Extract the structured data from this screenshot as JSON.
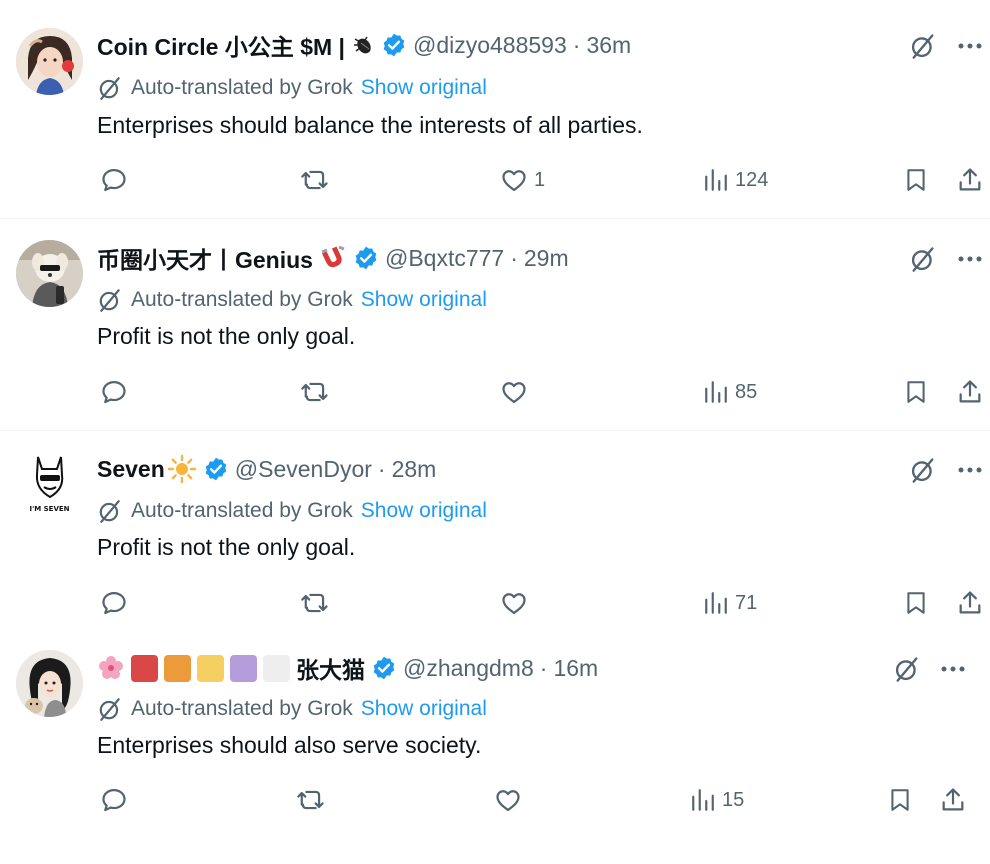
{
  "colors": {
    "verified": "#1d9bf0",
    "link": "#1d9bf0",
    "muted": "#536471",
    "text": "#0f1419"
  },
  "common": {
    "translated_label": "Auto-translated by Grok",
    "show_original": "Show original",
    "separator": "·"
  },
  "tweets": [
    {
      "name": "Coin Circle 小公主 $M |",
      "name_emoji": "bug",
      "handle": "@dizyo488593",
      "time": "36m",
      "text": "Enterprises should balance the interests of all parties.",
      "replies": "",
      "retweets": "",
      "likes": "1",
      "views": "124"
    },
    {
      "name": "币圈小天才丨Genius",
      "name_emoji": "magnet",
      "handle": "@Bqxtc777",
      "time": "29m",
      "text": "Profit is not the only goal.",
      "replies": "",
      "retweets": "",
      "likes": "",
      "views": "85"
    },
    {
      "name": "Seven",
      "name_emoji": "sun",
      "handle": "@SevenDyor",
      "time": "28m",
      "text": "Profit is not the only goal.",
      "replies": "",
      "retweets": "",
      "likes": "",
      "views": "71"
    },
    {
      "name": "张大猫",
      "name_emoji": "blossom-and-color-squares",
      "handle": "@zhangdm8",
      "time": "16m",
      "text": "Enterprises should also serve society.",
      "replies": "",
      "retweets": "",
      "likes": "",
      "views": "15",
      "swatch_colors": [
        "#d94747",
        "#ec9b3b",
        "#f5cf61",
        "#b59ddb",
        "#eeeeee"
      ]
    }
  ]
}
